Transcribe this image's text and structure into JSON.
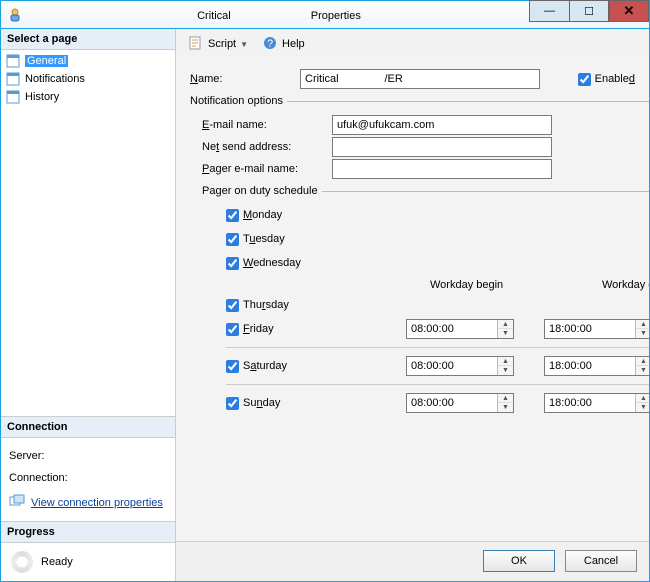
{
  "window": {
    "title_left": "Critical",
    "title_right": "Properties"
  },
  "sidebar": {
    "select_header": "Select a page",
    "items": [
      {
        "label": "General"
      },
      {
        "label": "Notifications"
      },
      {
        "label": "History"
      }
    ],
    "connection_header": "Connection",
    "server_label": "Server:",
    "connection_label": "Connection:",
    "view_props_link": "View connection properties",
    "progress_header": "Progress",
    "progress_status": "Ready"
  },
  "toolbar": {
    "script_label": "Script",
    "help_label": "Help"
  },
  "form": {
    "name_label": "Name:",
    "name_value": "Critical               /ER",
    "enabled_label": "Enabled",
    "enabled_checked": true,
    "notif_legend": "Notification options",
    "email_label": "E-mail name:",
    "email_value": "ufuk@ufukcam.com",
    "netsend_label": "Net send address:",
    "netsend_value": "",
    "pager_label": "Pager e-mail name:",
    "pager_value": "",
    "sched_legend": "Pager on duty schedule",
    "days": {
      "mon": "Monday",
      "tue": "Tuesday",
      "wed": "Wednesday",
      "thu": "Thursday",
      "fri": "Friday",
      "sat": "Saturday",
      "sun": "Sunday"
    },
    "workday_begin_label": "Workday begin",
    "workday_end_label": "Workday end",
    "time_friday_begin": "08:00:00",
    "time_friday_end": "18:00:00",
    "time_sat_begin": "08:00:00",
    "time_sat_end": "18:00:00",
    "time_sun_begin": "08:00:00",
    "time_sun_end": "18:00:00"
  },
  "footer": {
    "ok": "OK",
    "cancel": "Cancel"
  }
}
